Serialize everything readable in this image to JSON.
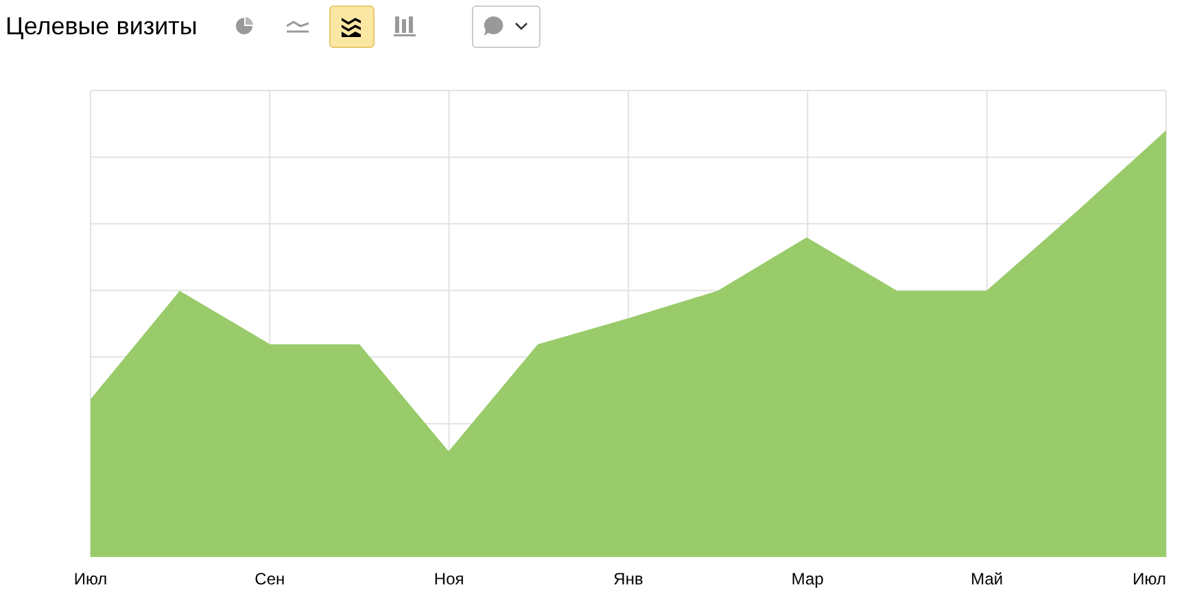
{
  "header": {
    "title": "Целевые визиты"
  },
  "view_buttons": [
    {
      "kind": "pie",
      "selected": false
    },
    {
      "kind": "line",
      "selected": false
    },
    {
      "kind": "area",
      "selected": true
    },
    {
      "kind": "bar",
      "selected": false
    }
  ],
  "chart": {
    "x_labels": [
      "Июл",
      "Сен",
      "Ноя",
      "Янв",
      "Мар",
      "Май",
      "Июл"
    ]
  }
}
